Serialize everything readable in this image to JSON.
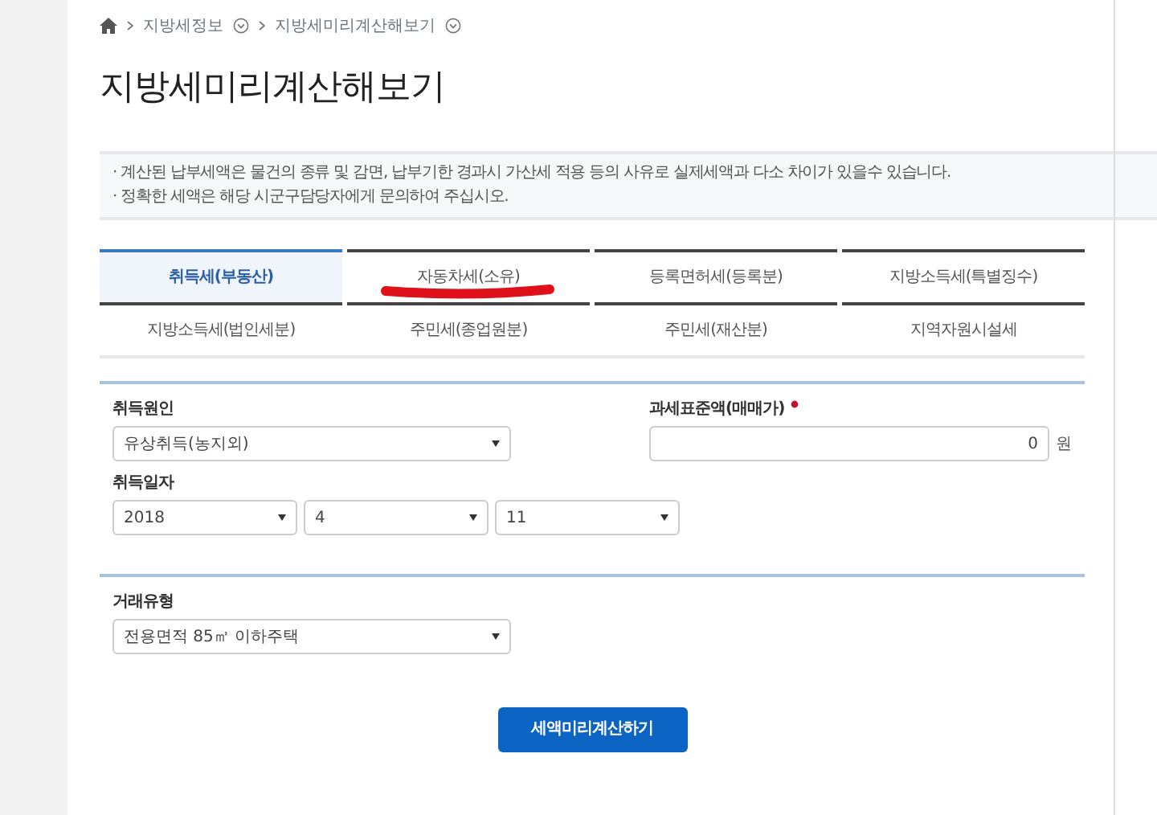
{
  "breadcrumb": [
    {
      "label": "지방세정보"
    },
    {
      "label": "지방세미리계산해보기"
    }
  ],
  "title": "지방세미리계산해보기",
  "notices": [
    "· 계산된 납부세액은 물건의 종류 및 감면, 납부기한 경과시 가산세 적용 등의 사유로 실제세액과 다소 차이가 있을수 있습니다.",
    "· 정확한 세액은 해당 시군구담당자에게 문의하여 주십시오."
  ],
  "tab_rows": [
    [
      {
        "label": "취득세(부동산)",
        "selected": true,
        "annotated": false
      },
      {
        "label": "자동차세(소유)",
        "selected": false,
        "annotated": true
      },
      {
        "label": "등록면허세(등록분)",
        "selected": false,
        "annotated": false
      },
      {
        "label": "지방소득세(특별징수)",
        "selected": false,
        "annotated": false
      }
    ],
    [
      {
        "label": "지방소득세(법인세분)",
        "selected": false,
        "annotated": false
      },
      {
        "label": "주민세(종업원분)",
        "selected": false,
        "annotated": false
      },
      {
        "label": "주민세(재산분)",
        "selected": false,
        "annotated": false
      },
      {
        "label": "지역자원시설세",
        "selected": false,
        "annotated": false
      }
    ]
  ],
  "sections": [
    {
      "fields": [
        {
          "kind": "select",
          "label": "취득원인",
          "value": "유상취득(농지외)"
        },
        {
          "kind": "amount",
          "label": "과세표준액(매매가)",
          "required": true,
          "value": "0",
          "unit": "원"
        },
        {
          "kind": "date",
          "label": "취득일자",
          "parts": [
            "2018",
            "4",
            "11"
          ]
        }
      ]
    },
    {
      "fields": [
        {
          "kind": "select",
          "label": "거래유형",
          "value": "전용면적 85㎡ 이하주택"
        }
      ]
    }
  ],
  "submit_button": "세액미리계산하기"
}
